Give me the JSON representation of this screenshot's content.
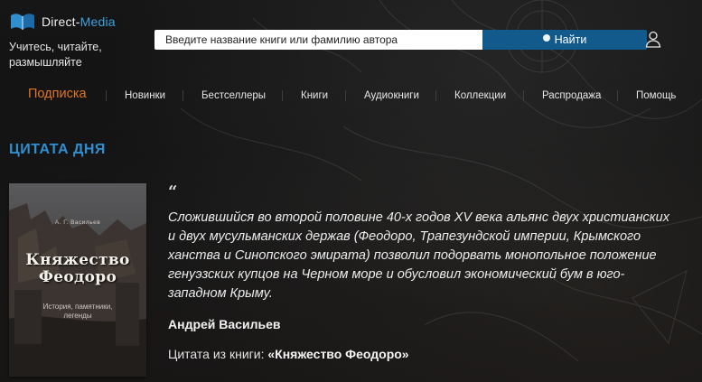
{
  "header": {
    "logo_text_prefix": "Direct-",
    "logo_text_accent": "Media",
    "tagline": "Учитесь, читайте, размышляйте",
    "search": {
      "placeholder": "Введите название книги или фамилию автора",
      "button_label": "Найти"
    },
    "icons": {
      "logo": "book-icon",
      "user": "user-icon"
    }
  },
  "nav": {
    "items": [
      {
        "label": "Подписка",
        "active": true
      },
      {
        "label": "Новинки"
      },
      {
        "label": "Бестселлеры"
      },
      {
        "label": "Книги"
      },
      {
        "label": "Аудиокниги"
      },
      {
        "label": "Коллекции"
      },
      {
        "label": "Распродажа"
      },
      {
        "label": "Помощь"
      }
    ]
  },
  "quote_section": {
    "title": "ЦИТАТА ДНЯ",
    "quote_mark": "“",
    "text": "Сложившийся во второй половине 40-х годов XV века альянс двух христианских и двух мусульманских держав (Феодоро, Трапезундской империи, Крымского ханства и Синопского эмирата) позволил подорвать монопольное положение генуэзских купцов на Черном море и обусловил экономический бум в юго-западном Крыму.",
    "author": "Андрей Васильев",
    "source_prefix": "Цитата из книги:",
    "source_title": "«Княжество Феодоро»",
    "book_cover": {
      "author": "А. Г. Васильев",
      "title_line1": "Княжество",
      "title_line2": "Феодоро",
      "subtitle_line1": "История, памятники,",
      "subtitle_line2": "легенды"
    }
  },
  "colors": {
    "accent_blue": "#2f8fd0",
    "search_button": "#125a8c",
    "active_nav": "#e0761e",
    "background": "#121212"
  }
}
